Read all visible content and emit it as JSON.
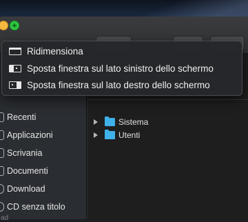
{
  "menu": {
    "items": [
      {
        "label": "Ridimensiona",
        "icon": "window-resize-icon"
      },
      {
        "label": "Sposta finestra sul lato sinistro dello schermo",
        "icon": "tile-left-icon"
      },
      {
        "label": "Sposta finestra sul lato destro dello schermo",
        "icon": "tile-right-icon"
      }
    ]
  },
  "sidebar": {
    "items": [
      {
        "label": "Recenti"
      },
      {
        "label": "Applicazioni"
      },
      {
        "label": "Scrivania"
      },
      {
        "label": "Documenti"
      },
      {
        "label": "Download"
      },
      {
        "label": "CD senza titolo"
      }
    ],
    "footer": "ad"
  },
  "content": {
    "rows": [
      {
        "name": "Sistema"
      },
      {
        "name": "Utenti"
      }
    ]
  },
  "colors": {
    "accent_folder": "#3fb0e8",
    "zoom_button": "#2ec840",
    "minimize_button": "#f5b840"
  }
}
